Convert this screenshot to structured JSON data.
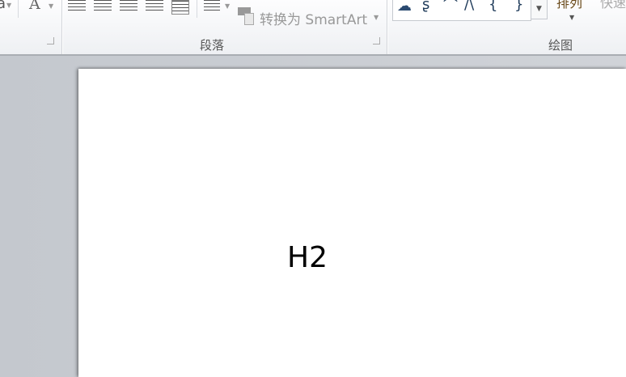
{
  "ribbon": {
    "paragraph_group": {
      "label": "段落",
      "smartart_label": "转换为 SmartArt"
    },
    "font_group": {
      "font_color_glyph": "A",
      "partial_glyph": "a"
    },
    "drawing_group": {
      "label": "绘图",
      "arrange_label": "排列",
      "quick_styles_label": "快速"
    }
  },
  "slide": {
    "text": "H2"
  }
}
